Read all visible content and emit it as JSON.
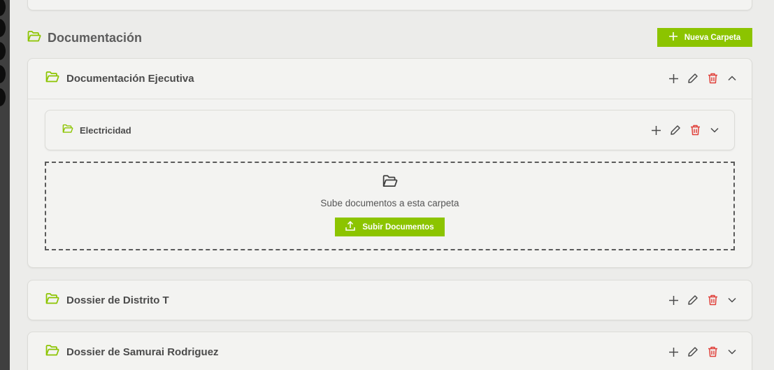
{
  "section": {
    "title": "Documentación",
    "new_folder_label": "Nueva Carpeta"
  },
  "folders": [
    {
      "title": "Documentación Ejecutiva",
      "expanded": true,
      "subfolders": [
        {
          "title": "Electricidad"
        }
      ],
      "dropzone": {
        "text": "Sube documentos a esta carpeta",
        "button_label": "Subir Documentos"
      }
    },
    {
      "title": "Dossier de Distrito T",
      "expanded": false
    },
    {
      "title": "Dossier de Samurai Rodriguez",
      "expanded": false
    }
  ],
  "colors": {
    "accent": "#8cc400",
    "danger": "#e0403a",
    "text": "#4b4b4b"
  },
  "icons": {
    "folder": "folder-open-icon",
    "add": "plus-icon",
    "edit": "pencil-icon",
    "delete": "trash-icon",
    "collapse": "chevron-up-icon",
    "expand": "chevron-down-icon",
    "upload": "upload-icon"
  }
}
